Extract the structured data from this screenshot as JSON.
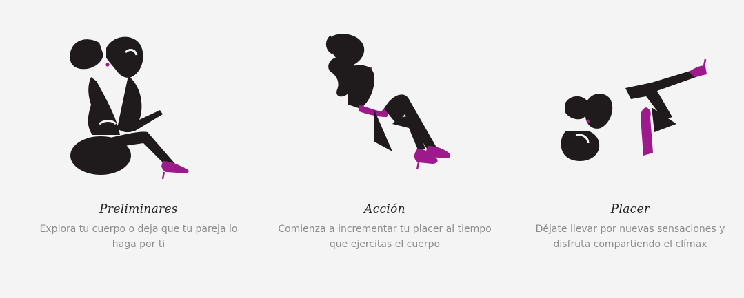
{
  "colors": {
    "background": "#f4f4f4",
    "silhouette": "#1f1b1c",
    "accent": "#9c1a8c",
    "title": "#222222",
    "text": "#8c8c8c"
  },
  "features": [
    {
      "icon": "kissing-couple-icon",
      "title": "Preliminares",
      "description": "Explora tu cuerpo o deja que tu pareja lo haga por ti"
    },
    {
      "icon": "reclining-couple-icon",
      "title": "Acción",
      "description": "Comienza a incrementar tu placer al tiempo que ejercitas el cuerpo"
    },
    {
      "icon": "legs-up-couple-icon",
      "title": "Placer",
      "description": "Déjate llevar por nuevas sensaciones y disfruta compartiendo el clímax"
    }
  ]
}
